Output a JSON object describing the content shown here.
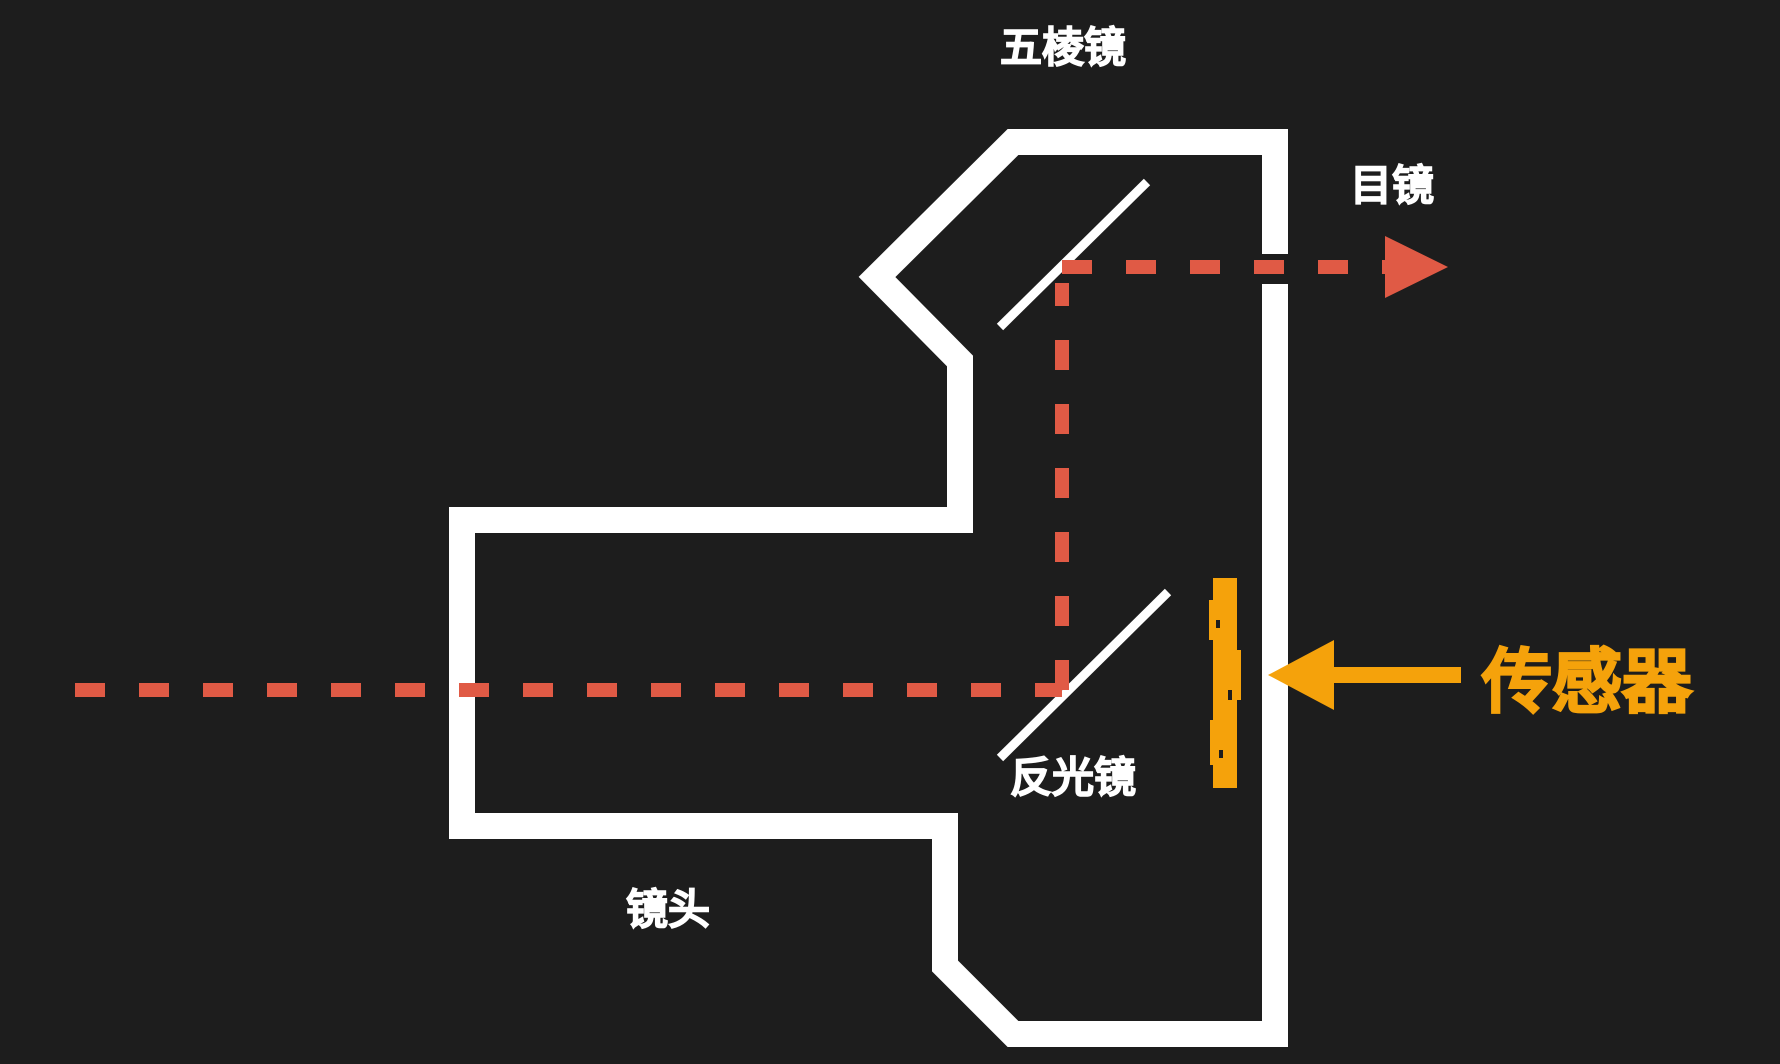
{
  "labels": {
    "pentaprism": "五棱镜",
    "eyepiece": "目镜",
    "sensor": "传感器",
    "reflex_mirror": "反光镜",
    "lens": "镜头"
  },
  "colors": {
    "background": "#1d1d1d",
    "outline": "#ffffff",
    "light_path": "#e05a45",
    "sensor": "#f5a20b"
  }
}
